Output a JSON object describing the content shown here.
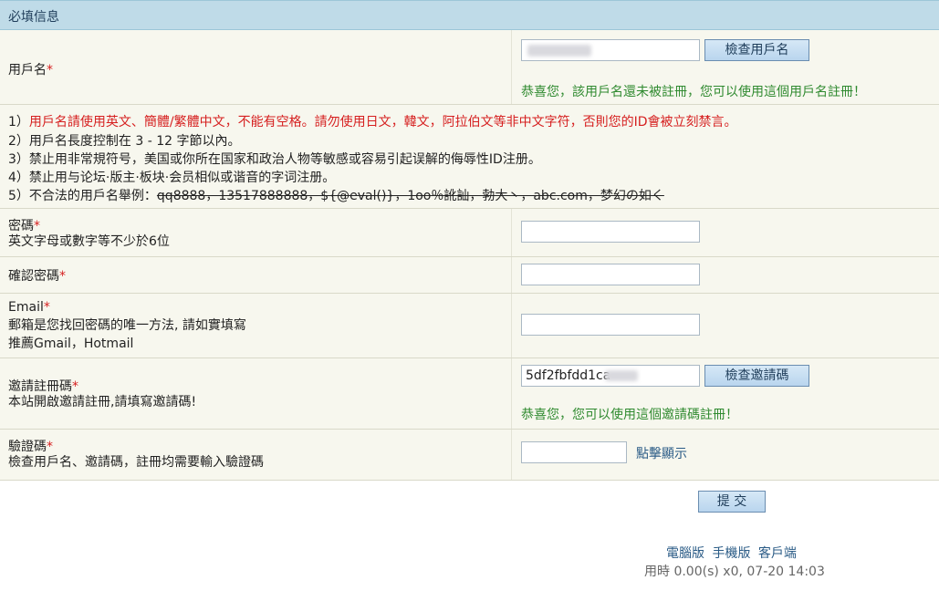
{
  "section_title": "必填信息",
  "username": {
    "label": "用戶名",
    "required_mark": "*",
    "check_button": "檢查用戶名",
    "success": "恭喜您，該用戶名還未被註冊，您可以使用這個用戶名註冊！"
  },
  "rules": {
    "line1_prefix": "1）",
    "line1_text": "用戶名請使用英文、簡體/繁體中文，不能有空格。請勿使用日文，韓文，阿拉伯文等非中文字符，否則您的ID會被立刻禁言。",
    "line2": "2）用戶名長度控制在 3 - 12 字節以內。",
    "line3": "3）禁止用非常規符号，美国或你所在国家和政治人物等敏感或容易引起误解的侮辱性ID注册。",
    "line4": "4）禁止用与论坛·版主·板块·会员相似或谐音的字词注册。",
    "line5_prefix": "5）不合法的用戶名舉例：",
    "line5_examples": "qq8888，13517888888，${@eval()}，1oo％訛訕，勃大丶，abc.com，梦幻の如く"
  },
  "password": {
    "label": "密碼",
    "required_mark": "*",
    "hint": "英文字母或數字等不少於6位"
  },
  "confirm_password": {
    "label": "確認密碼",
    "required_mark": "*"
  },
  "email": {
    "label": "Email",
    "required_mark": "*",
    "hint_red": "郵箱是您找回密碼的唯一方法, 請如實填寫",
    "hint": "推薦Gmail，Hotmail"
  },
  "invite": {
    "label": "邀請註冊碼",
    "required_mark": "*",
    "hint": "本站開啟邀請註冊,請填寫邀請碼!",
    "value": "5df2fbfdd1ca",
    "check_button": "檢查邀請碼",
    "success": "恭喜您，您可以使用這個邀請碼註冊！"
  },
  "captcha": {
    "label": "驗證碼",
    "required_mark": "*",
    "hint": "檢查用戶名、邀請碼，註冊均需要輸入驗證碼",
    "show_link": "點擊顯示"
  },
  "submit_button": "提 交",
  "footer": {
    "link_desktop": "電腦版",
    "link_mobile": "手機版",
    "link_client": "客戶端",
    "meta": "用時 0.00(s) x0, 07-20 14:03"
  },
  "colors": {
    "header_bg": "#bfdbe8",
    "row_bg": "#f7f7ee",
    "required": "#d62020",
    "success": "#2f8a2f",
    "link": "#2a5b86"
  }
}
